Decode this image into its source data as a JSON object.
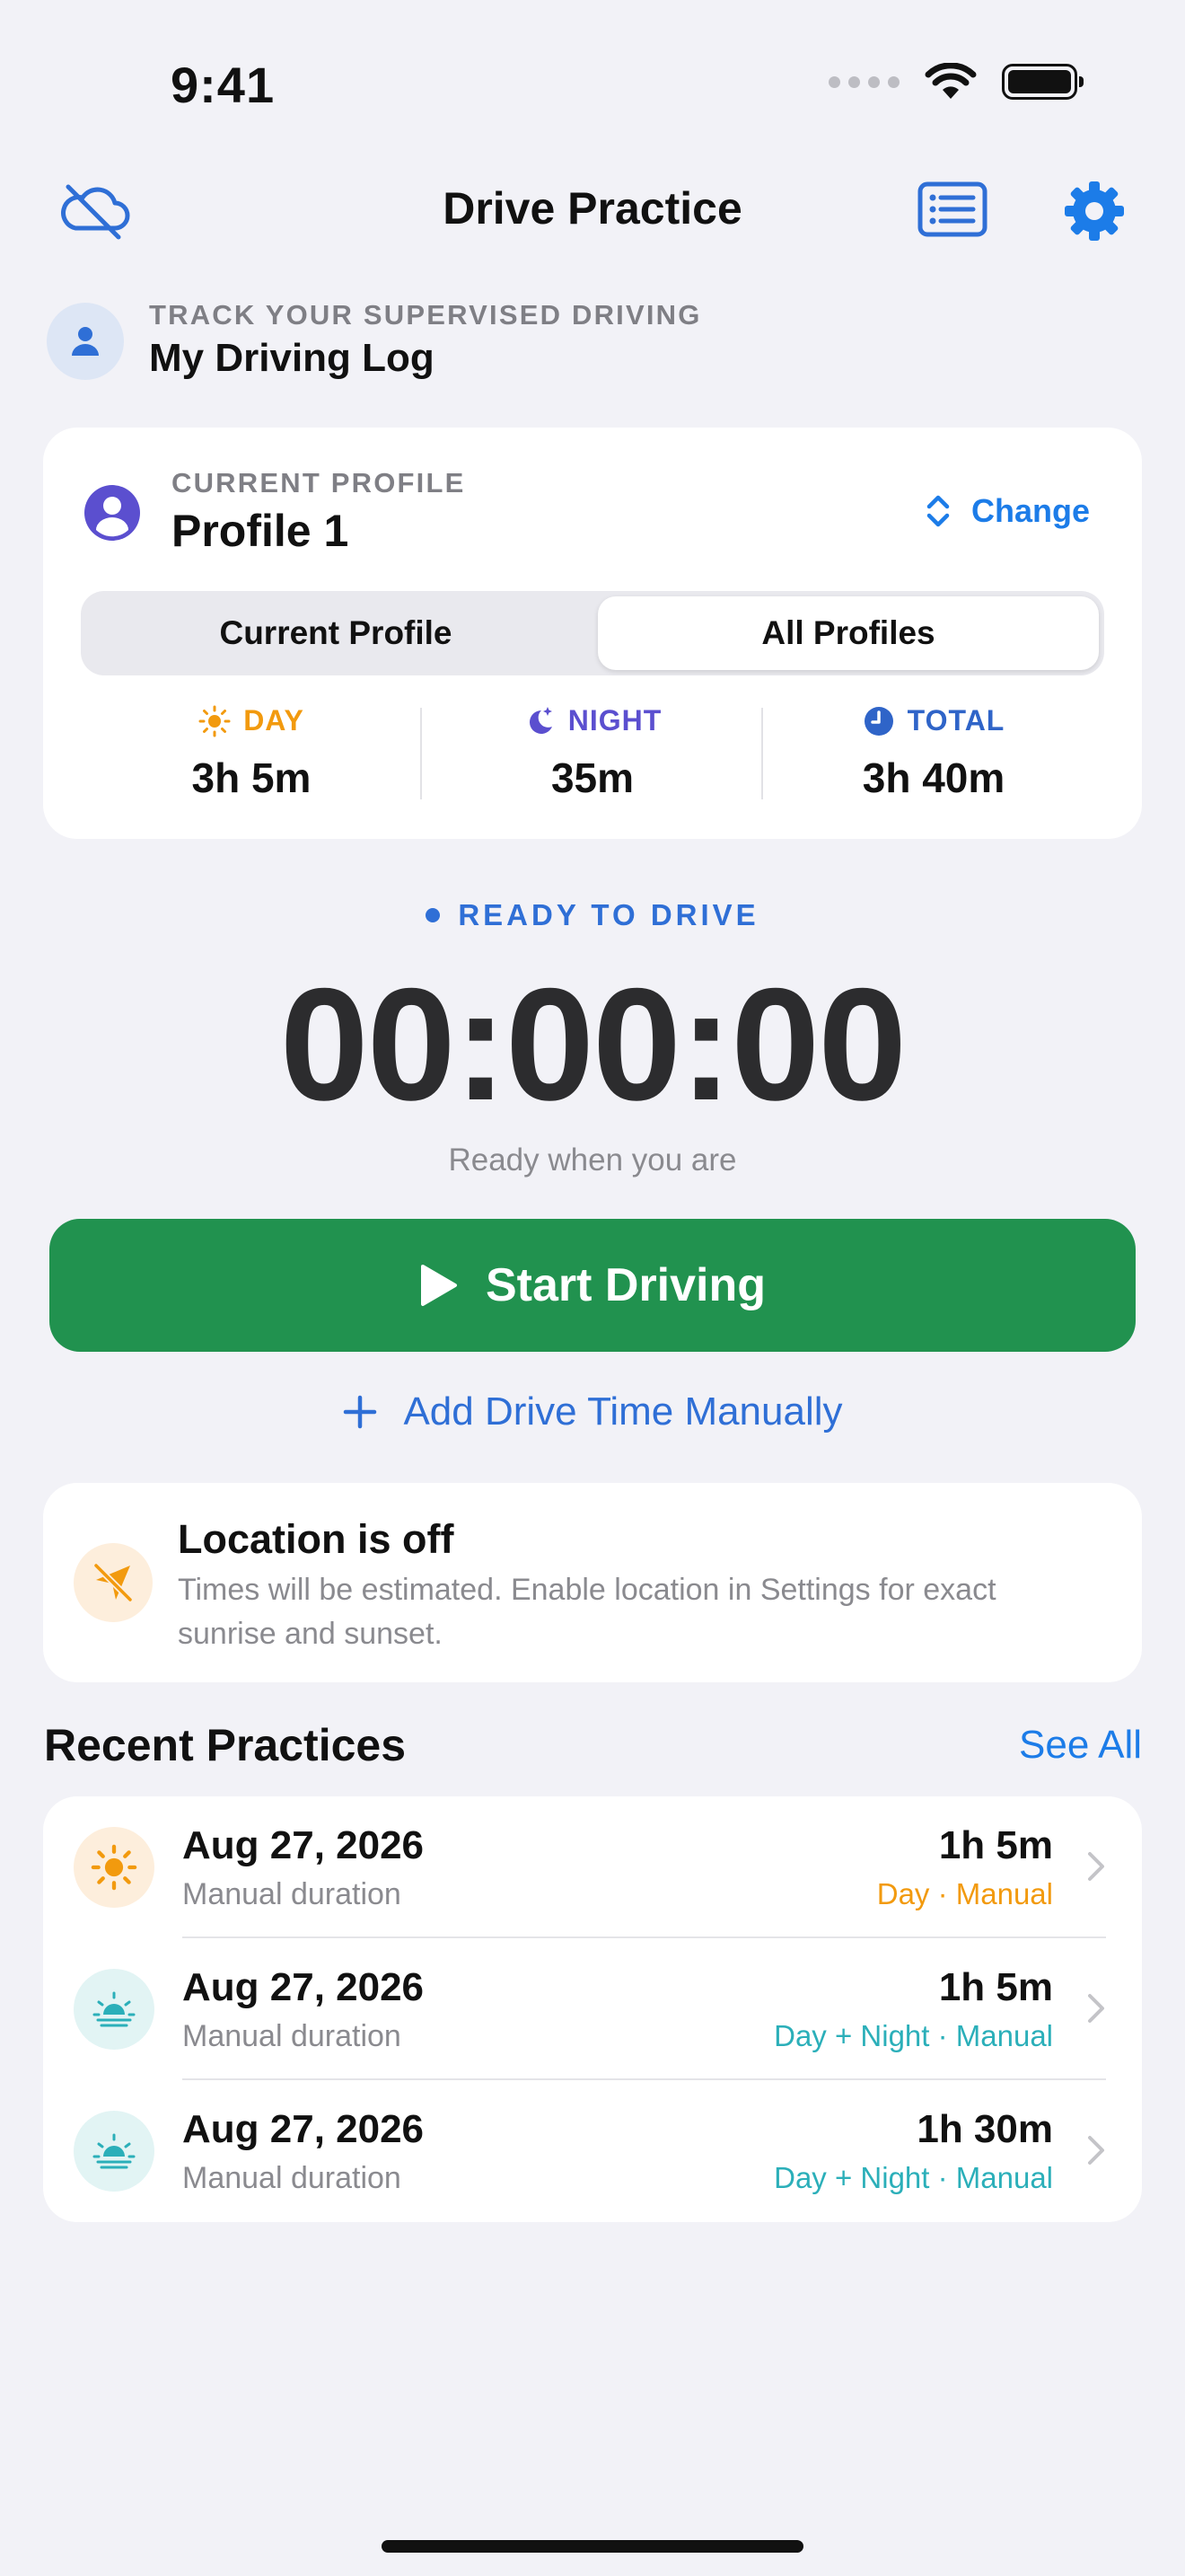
{
  "status_bar": {
    "time": "9:41"
  },
  "nav": {
    "title": "Drive Practice"
  },
  "header": {
    "eyebrow": "TRACK YOUR SUPERVISED DRIVING",
    "title": "My Driving Log"
  },
  "profile_card": {
    "eyebrow": "CURRENT PROFILE",
    "name": "Profile 1",
    "change_label": "Change",
    "segments": [
      "Current Profile",
      "All Profiles"
    ],
    "selected_segment": "All Profiles",
    "stats": [
      {
        "label": "DAY",
        "value": "3h 5m",
        "icon": "sun-icon",
        "color": "#F29A0E"
      },
      {
        "label": "NIGHT",
        "value": "35m",
        "icon": "moon-stars-icon",
        "color": "#5B4FCF"
      },
      {
        "label": "TOTAL",
        "value": "3h 40m",
        "icon": "clock-icon",
        "color": "#2F64C8"
      }
    ]
  },
  "drive": {
    "status": "READY TO DRIVE",
    "timer": "00:00:00",
    "subtitle": "Ready when you are",
    "start_label": "Start Driving",
    "manual_label": "Add Drive Time Manually"
  },
  "location_notice": {
    "title": "Location is off",
    "body": "Times will be estimated. Enable location in Settings for exact sunrise and sunset."
  },
  "recent": {
    "title": "Recent Practices",
    "see_all": "See All",
    "items": [
      {
        "date": "Aug 27, 2026",
        "subtitle": "Manual duration",
        "duration": "1h 5m",
        "tag": "Day · Manual",
        "tag_color": "#F29A0E",
        "icon": "sun-icon"
      },
      {
        "date": "Aug 27, 2026",
        "subtitle": "Manual duration",
        "duration": "1h 5m",
        "tag": "Day + Night · Manual",
        "tag_color": "#2BAFB9",
        "icon": "sunset-icon"
      },
      {
        "date": "Aug 27, 2026",
        "subtitle": "Manual duration",
        "duration": "1h 30m",
        "tag": "Day + Night · Manual",
        "tag_color": "#2BAFB9",
        "icon": "sunset-icon"
      }
    ]
  },
  "colors": {
    "accent": "#2F6FD6",
    "link": "#1C7CE8",
    "start_green": "#21924F",
    "day": "#F29A0E",
    "night": "#5B4FCF",
    "mixed": "#2BAFB9"
  }
}
